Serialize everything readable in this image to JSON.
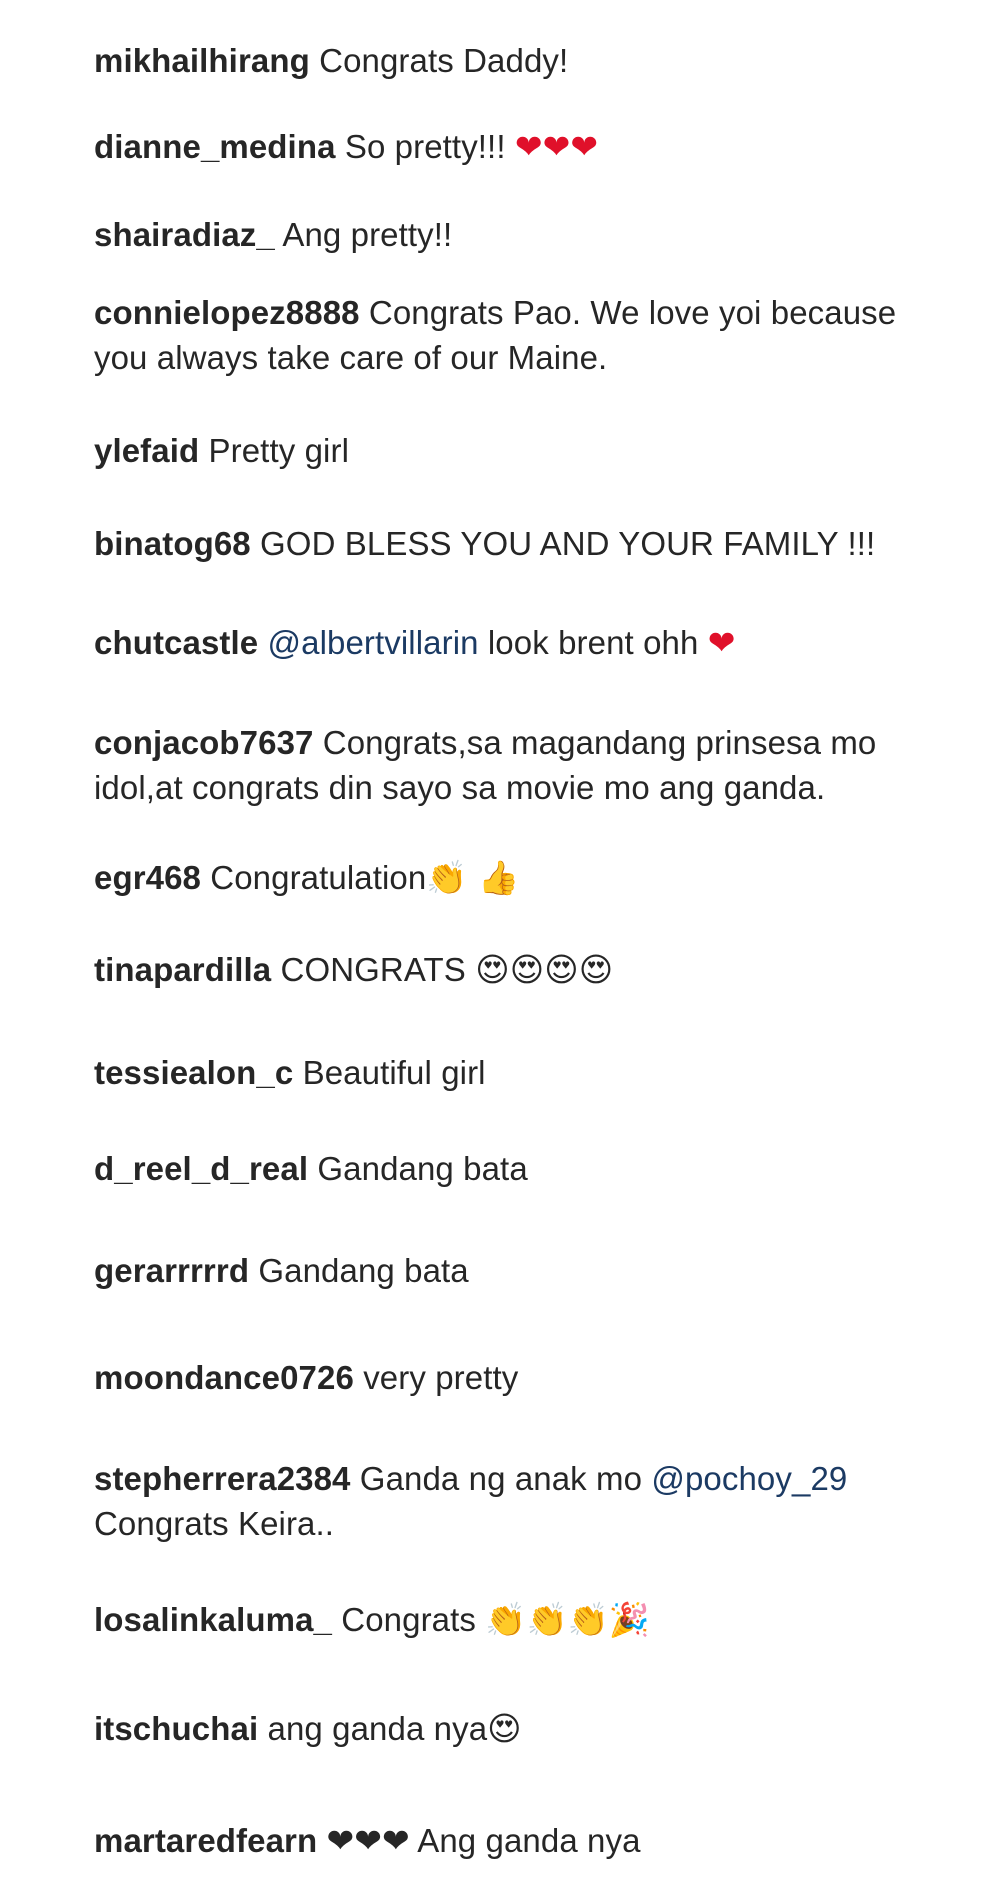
{
  "comments": [
    {
      "user": "mikhailhirang",
      "text": "Congrats Daddy!"
    },
    {
      "user": "dianne_medina",
      "text": "So pretty!!!",
      "emoji": "❤❤❤"
    },
    {
      "user": "shairadiaz_",
      "text": "Ang pretty!!"
    },
    {
      "user": "connielopez8888",
      "text": "Congrats Pao. We love yoi because you always take care of our Maine."
    },
    {
      "user": "ylefaid",
      "text": "Pretty girl"
    },
    {
      "user": "binatog68",
      "text": "GOD BLESS YOU AND YOUR FAMILY !!!"
    },
    {
      "user": "chutcastle",
      "mention": "@albertvillarin",
      "text": "look brent ohh",
      "emoji": "❤"
    },
    {
      "user": "conjacob7637",
      "text": "Congrats,sa magandang prinsesa mo idol,at congrats din sayo sa movie mo ang ganda."
    },
    {
      "user": "egr468",
      "text": "Congratulation",
      "emoji": "👏 👍"
    },
    {
      "user": "tinapardilla",
      "text": "CONGRATS",
      "emoji": "😍😍😍😍"
    },
    {
      "user": "tessiealon_c",
      "text": "Beautiful girl"
    },
    {
      "user": "d_reel_d_real",
      "text": "Gandang bata"
    },
    {
      "user": "gerarrrrrd",
      "text": "Gandang bata"
    },
    {
      "user": "moondance0726",
      "text": "very pretty"
    },
    {
      "user": "stepherrera2384",
      "text": "Ganda ng anak mo",
      "mention": "@pochoy_29",
      "text2": "Congrats Keira.."
    },
    {
      "user": "losalinkaluma_",
      "text": "Congrats",
      "emoji": "👏👏👏🎉"
    },
    {
      "user": "itschuchai",
      "text": "ang ganda nya",
      "emoji": "😍"
    },
    {
      "user": "martaredfearn",
      "emoji": "❤❤❤",
      "text": "Ang ganda nya"
    }
  ]
}
